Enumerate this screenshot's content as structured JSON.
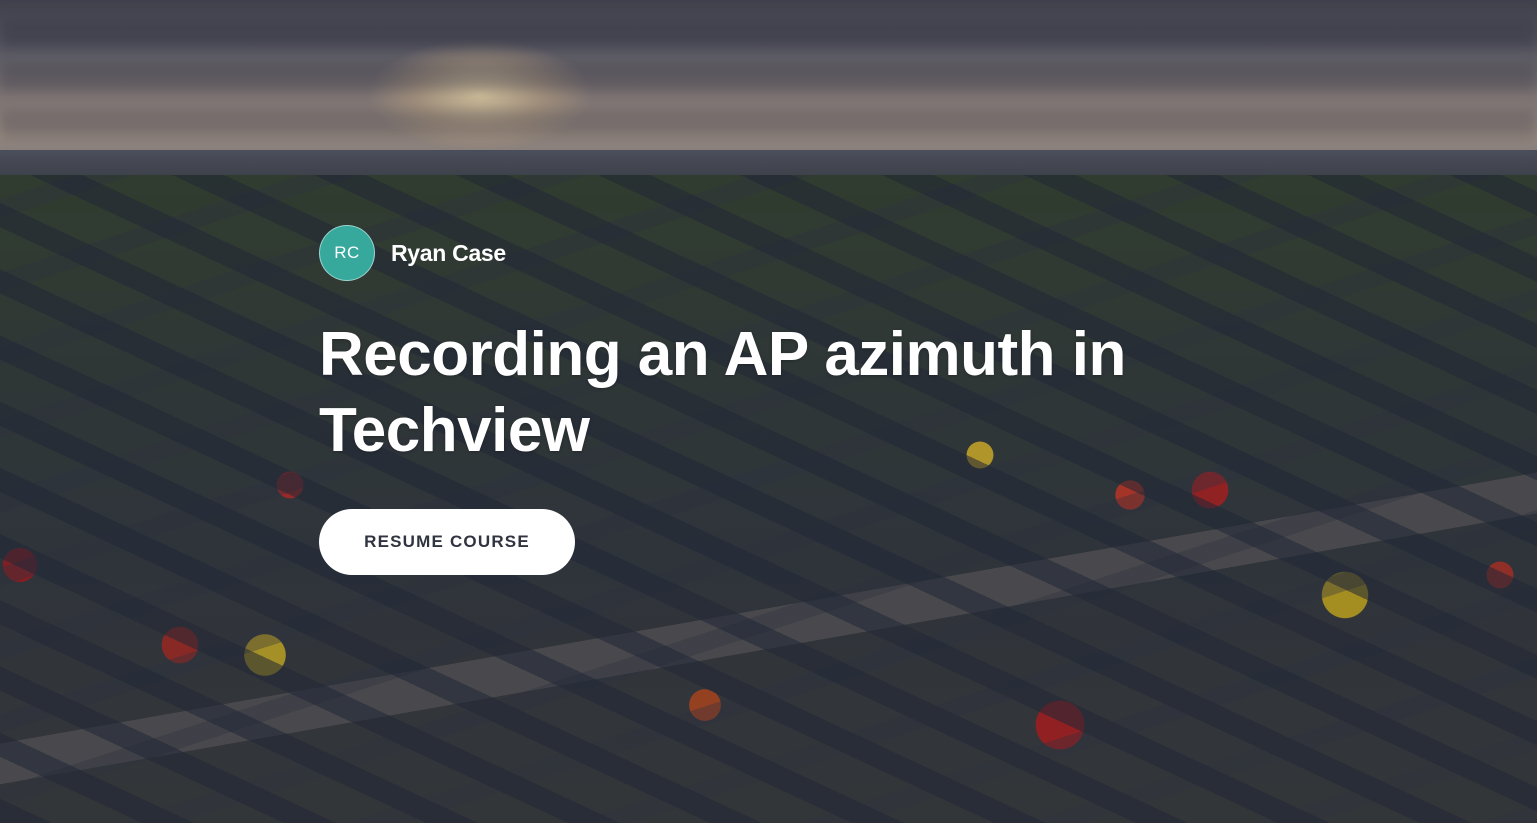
{
  "author": {
    "initials": "RC",
    "name": "Ryan Case",
    "avatar_color": "#36a89c"
  },
  "course": {
    "title": "Recording an AP azimuth in Techview"
  },
  "actions": {
    "resume_label": "RESUME COURSE"
  },
  "background": {
    "description_icon": "aerial-neighborhood-photo"
  }
}
